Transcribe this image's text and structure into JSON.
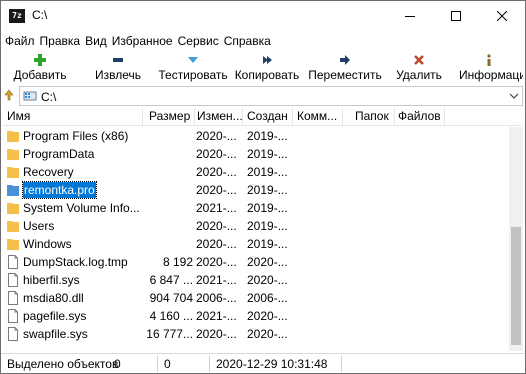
{
  "window": {
    "app_icon_text": "7z",
    "title": "C:\\"
  },
  "menu": [
    "Файл",
    "Правка",
    "Вид",
    "Избранное",
    "Сервис",
    "Справка"
  ],
  "toolbar": [
    {
      "label": "Добавить",
      "icon": "plus-icon",
      "color": "#2aa52a"
    },
    {
      "label": "Извлечь",
      "icon": "minus-icon",
      "color": "#1f3f66"
    },
    {
      "label": "Тестировать",
      "icon": "check-icon",
      "color": "#3fa0d8"
    },
    {
      "label": "Копировать",
      "icon": "arrows-icon",
      "color": "#1f3f66"
    },
    {
      "label": "Переместить",
      "icon": "arrow-right-icon",
      "color": "#1f3f66"
    },
    {
      "label": "Удалить",
      "icon": "x-icon",
      "color": "#b84a2a"
    },
    {
      "label": "Информаци",
      "icon": "info-icon",
      "color": "#8a6a2a"
    }
  ],
  "address": {
    "path": "C:\\"
  },
  "columns": [
    "Имя",
    "Размер",
    "Измен...",
    "Создан",
    "Комм...",
    "Папок",
    "Файлов"
  ],
  "rows": [
    {
      "name": "Program Files (x86)",
      "size": "",
      "modified": "2020-...",
      "created": "2019-...",
      "type": "folder",
      "selected": false
    },
    {
      "name": "ProgramData",
      "size": "",
      "modified": "2020-...",
      "created": "2019-...",
      "type": "folder",
      "selected": false
    },
    {
      "name": "Recovery",
      "size": "",
      "modified": "2020-...",
      "created": "2019-...",
      "type": "folder",
      "selected": false
    },
    {
      "name": "remontka.pro",
      "size": "",
      "modified": "2020-...",
      "created": "2019-...",
      "type": "folder-blue",
      "selected": true
    },
    {
      "name": "System Volume Info...",
      "size": "",
      "modified": "2021-...",
      "created": "2019-...",
      "type": "folder",
      "selected": false
    },
    {
      "name": "Users",
      "size": "",
      "modified": "2020-...",
      "created": "2019-...",
      "type": "folder",
      "selected": false
    },
    {
      "name": "Windows",
      "size": "",
      "modified": "2020-...",
      "created": "2019-...",
      "type": "folder",
      "selected": false
    },
    {
      "name": "DumpStack.log.tmp",
      "size": "8 192",
      "modified": "2020-...",
      "created": "2020-...",
      "type": "file",
      "selected": false
    },
    {
      "name": "hiberfil.sys",
      "size": "6 847 ...",
      "modified": "2021-...",
      "created": "2020-...",
      "type": "file",
      "selected": false
    },
    {
      "name": "msdia80.dll",
      "size": "904 704",
      "modified": "2006-...",
      "created": "2006-...",
      "type": "file",
      "selected": false
    },
    {
      "name": "pagefile.sys",
      "size": "4 160 ...",
      "modified": "2021-...",
      "created": "2020-...",
      "type": "file",
      "selected": false
    },
    {
      "name": "swapfile.sys",
      "size": "16 777...",
      "modified": "2020-...",
      "created": "2020-...",
      "type": "file",
      "selected": false
    }
  ],
  "status": {
    "selected": "Выделено объектов",
    "sel_count": "0",
    "size": "0",
    "date": "2020-12-29 10:31:48"
  },
  "colors": {
    "folder": "#f4c04b",
    "folder_blue": "#4a90d9",
    "selection": "#0078d7"
  }
}
